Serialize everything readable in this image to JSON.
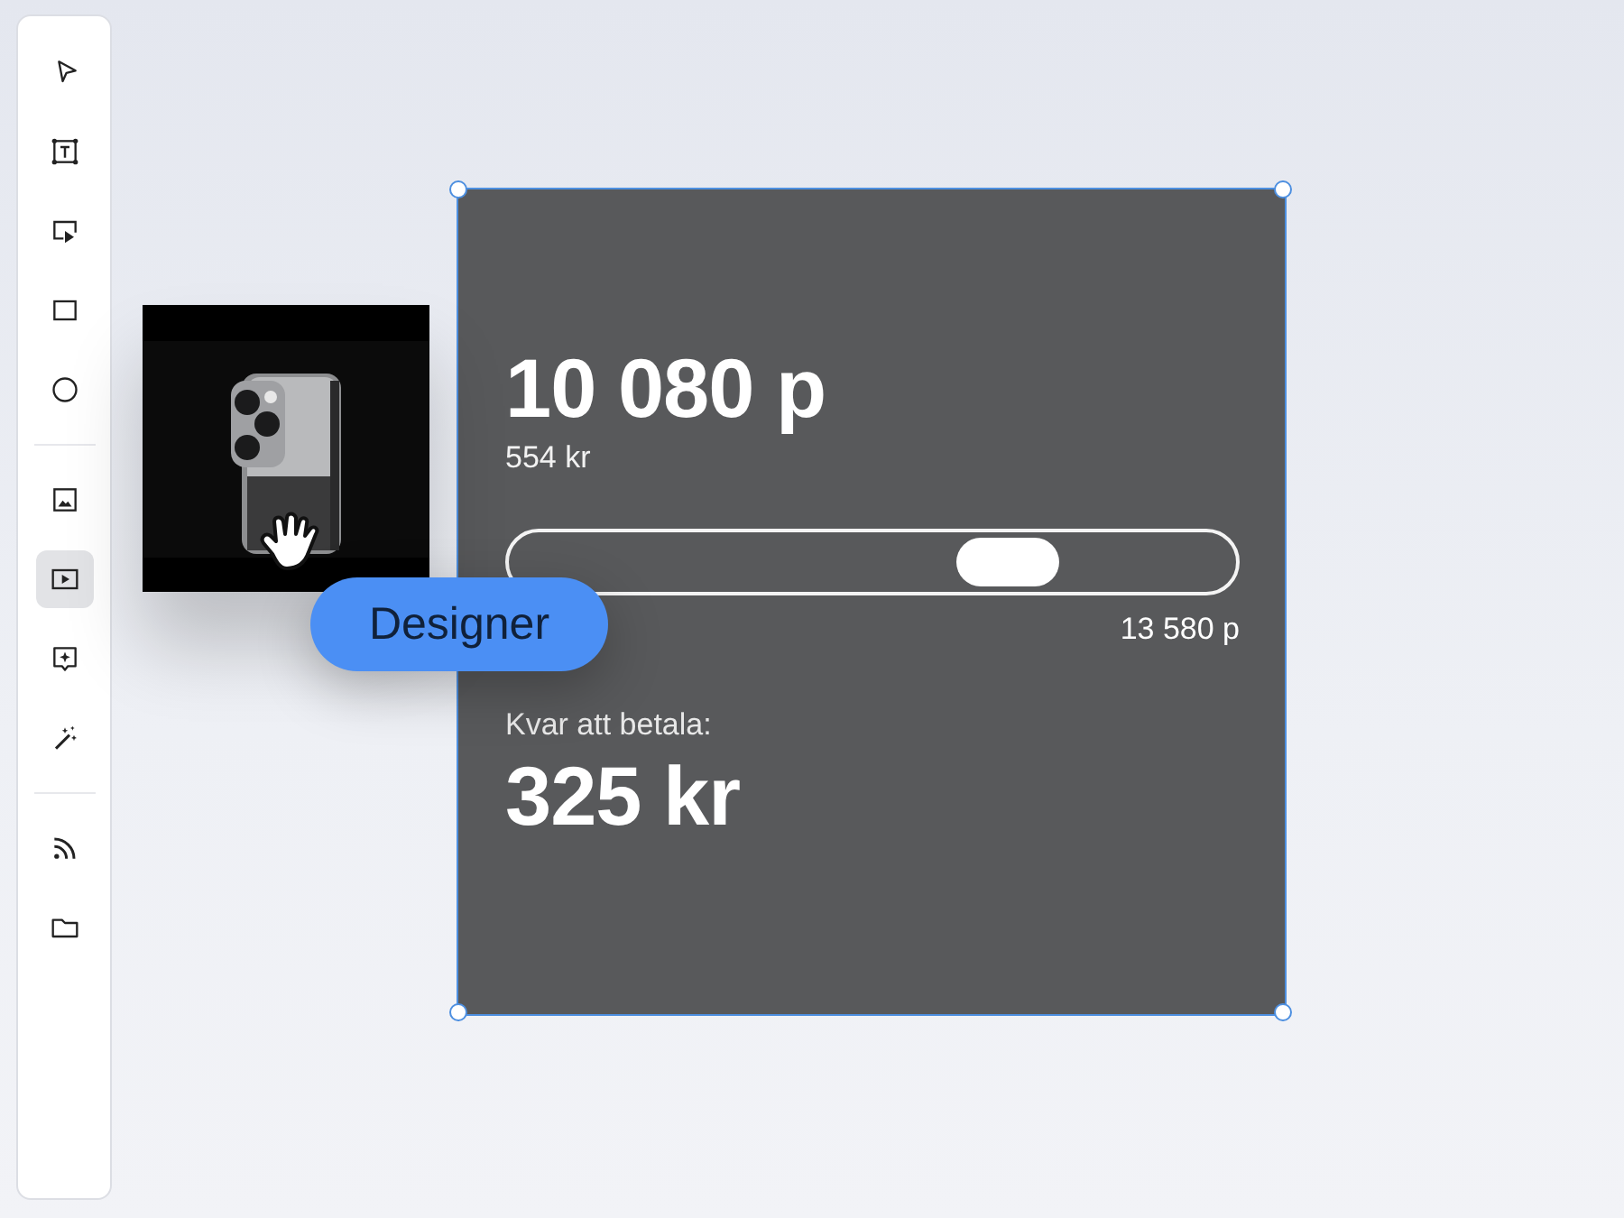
{
  "toolbar": {
    "groups": [
      [
        {
          "selected": false
        },
        {
          "selected": false
        },
        {
          "selected": false
        },
        {
          "selected": false
        },
        {
          "selected": false
        }
      ],
      [
        {
          "selected": false
        },
        {
          "selected": true
        },
        {
          "selected": false
        },
        {
          "selected": false
        }
      ],
      [
        {
          "selected": false
        },
        {
          "selected": false
        }
      ]
    ]
  },
  "canvas": {
    "badge": {
      "label": "Designer"
    },
    "frame": {
      "selected": true,
      "amount": "10 080 p",
      "amount_sub": "554 kr",
      "slider": {
        "level": 0.71,
        "max_label": "13 580 p"
      },
      "remaining_label": "Kvar att betala:",
      "remaining": "325 kr"
    }
  }
}
